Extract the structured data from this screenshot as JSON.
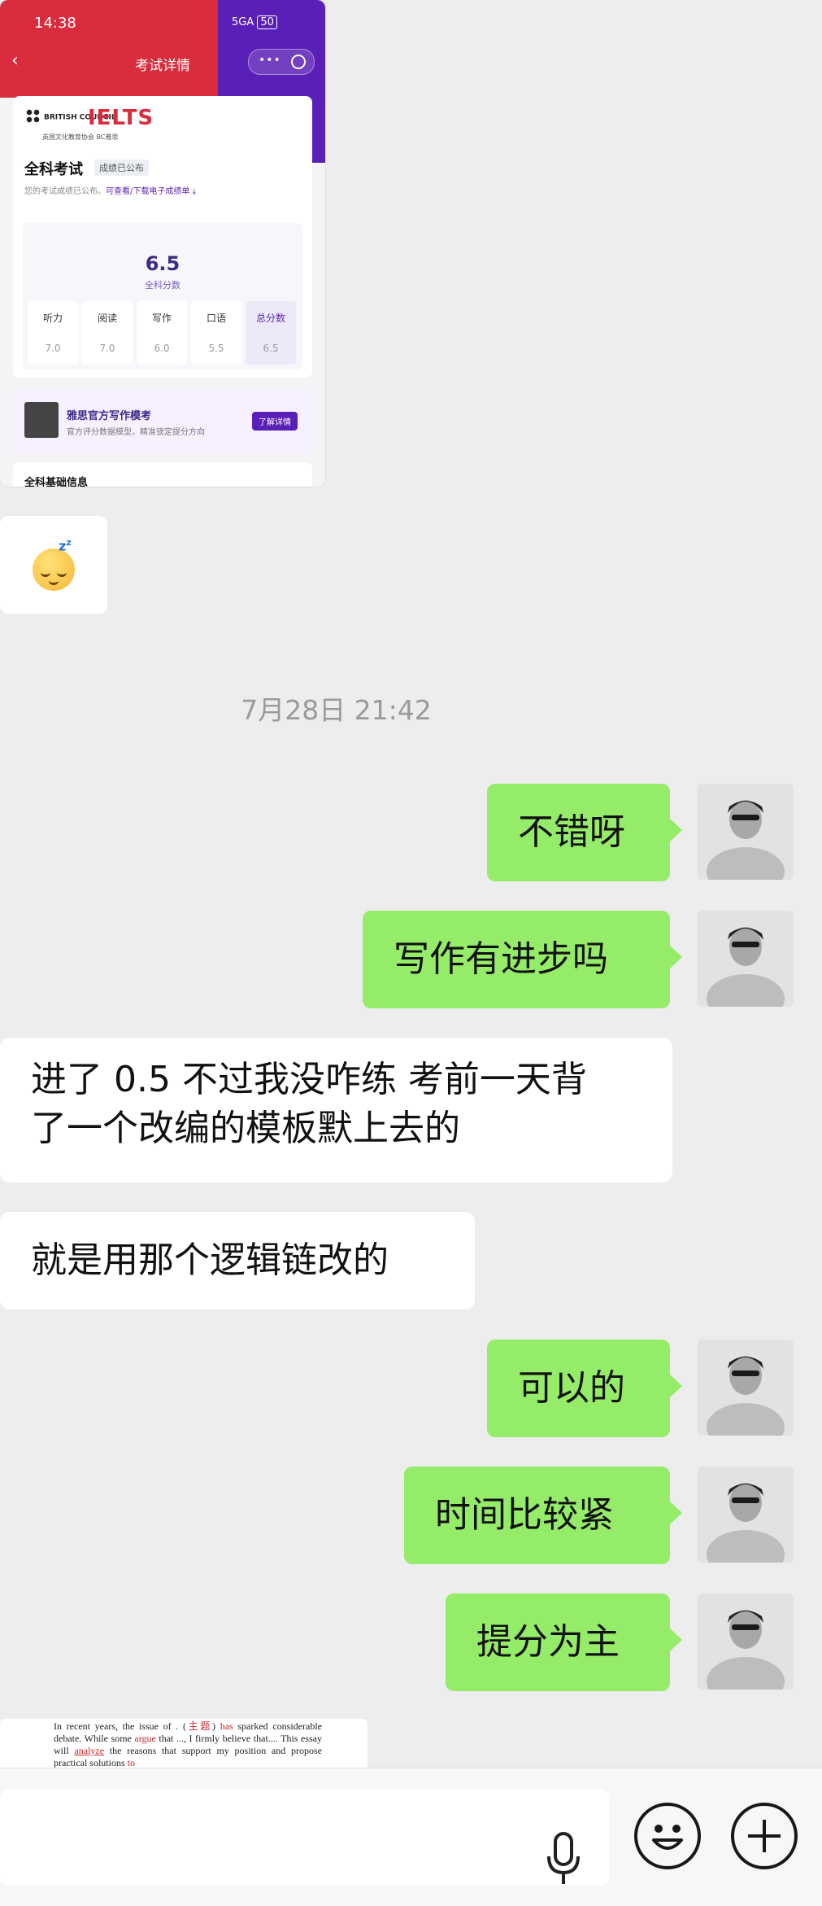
{
  "screenshot": {
    "time": "14:38",
    "signal": "5GA",
    "battery": "50",
    "nav_title": "考试详情",
    "brand_small": "BRITISH COUNCIL",
    "brand_big": "IELTS",
    "brand_sub": "英国文化教育协会 BC雅思",
    "exam_title": "全科考试",
    "status_badge": "成绩已公布",
    "note_prefix": "您的考试成绩已公布。",
    "note_link": "可查看/下载电子成绩单",
    "overall_score": "6.5",
    "overall_label": "全科分数",
    "scores": [
      {
        "name": "听力",
        "value": "7.0"
      },
      {
        "name": "阅读",
        "value": "7.0"
      },
      {
        "name": "写作",
        "value": "6.0"
      },
      {
        "name": "口语",
        "value": "5.5"
      },
      {
        "name": "总分数",
        "value": "6.5"
      }
    ],
    "banner_title": "雅思官方写作模考",
    "banner_sub": "官方评分数据模型，精准锁定提分方向",
    "banner_button": "了解详情",
    "info_title": "全科基础信息"
  },
  "timestamp": "7月28日 21:42",
  "messages": [
    {
      "from": "me",
      "text": "不错呀"
    },
    {
      "from": "me",
      "text": "写作有进步吗"
    },
    {
      "from": "them",
      "line1": "进了 0.5 不过我没咋练 考前一天背",
      "line2": "了一个改编的模板默上去的"
    },
    {
      "from": "them",
      "text": "就是用那个逻辑链改的"
    },
    {
      "from": "me",
      "text": "可以的"
    },
    {
      "from": "me",
      "text": "时间比较紧"
    },
    {
      "from": "me",
      "text": "提分为主"
    }
  ],
  "essay": {
    "s1": "In recent years, the issue of . (",
    "s2": "主题",
    "s3": ") ",
    "s4": "has",
    "s5": " sparked considerable debate. While some ",
    "s6": "argue",
    "s7": " that ..., I firmly believe that.... This essay will ",
    "s8": "analyze",
    "s9": " the reasons that support my position and propose practical solutions ",
    "s10": "to"
  },
  "colors": {
    "my_bubble": "#95ec69",
    "their_bubble": "#ffffff",
    "background": "#ededed",
    "ielts_red": "#d92c3c",
    "ielts_purple": "#5a1fb7"
  }
}
